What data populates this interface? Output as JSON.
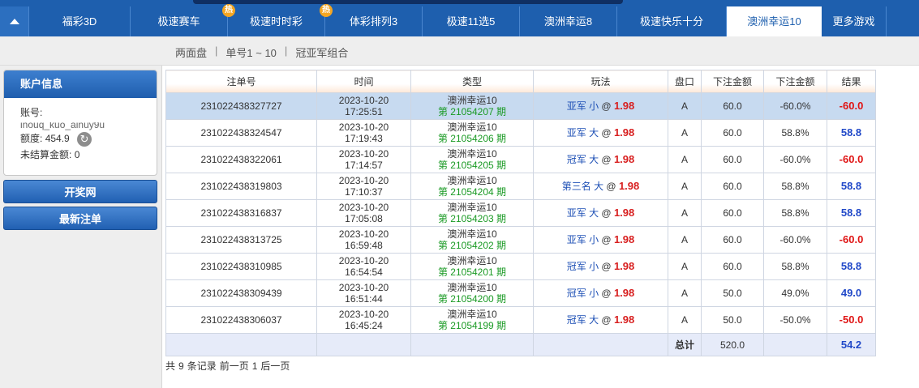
{
  "nav": {
    "tabs": [
      {
        "label": "福彩3D",
        "hot": false,
        "active": false
      },
      {
        "label": "极速赛车",
        "hot": true,
        "active": false
      },
      {
        "label": "极速时时彩",
        "hot": true,
        "active": false
      },
      {
        "label": "体彩排列3",
        "hot": false,
        "active": false
      },
      {
        "label": "极速11选5",
        "hot": false,
        "active": false
      },
      {
        "label": "澳洲幸运8",
        "hot": false,
        "active": false
      },
      {
        "label": "极速快乐十分",
        "hot": false,
        "active": false
      },
      {
        "label": "澳洲幸运10",
        "hot": false,
        "active": true
      },
      {
        "label": "更多游戏",
        "hot": false,
        "active": false
      }
    ],
    "hot_label": "热"
  },
  "subnav": {
    "items": [
      "两面盘",
      "单号1 ~ 10",
      "冠亚军组合"
    ],
    "separator": "|"
  },
  "sidebar": {
    "account_title": "账户信息",
    "account_label": "账号:",
    "account_value_masked": "inouq_kuo_ainuy9u",
    "quota_label": "额度:",
    "quota_value": "454.9",
    "unsettled_label": "未结算金额:",
    "unsettled_value": "0",
    "refresh_icon": "↻",
    "buttons": [
      "开奖网",
      "最新注单"
    ]
  },
  "table": {
    "headers": [
      "注单号",
      "时间",
      "类型",
      "玩法",
      "盘口",
      "下注金额",
      "下注金额",
      "结果"
    ],
    "rows": [
      {
        "id": "231022438327727",
        "date": "2023-10-20",
        "time": "17:25:51",
        "game": "澳洲幸运10",
        "issue": "第 21054207 期",
        "play": "亚军 小",
        "at": "@",
        "odds": "1.98",
        "pan": "A",
        "amount": "60.0",
        "pct": "-60.0%",
        "result": "-60.0",
        "sign": "neg"
      },
      {
        "id": "231022438324547",
        "date": "2023-10-20",
        "time": "17:19:43",
        "game": "澳洲幸运10",
        "issue": "第 21054206 期",
        "play": "亚军 大",
        "at": "@",
        "odds": "1.98",
        "pan": "A",
        "amount": "60.0",
        "pct": "58.8%",
        "result": "58.8",
        "sign": "pos"
      },
      {
        "id": "231022438322061",
        "date": "2023-10-20",
        "time": "17:14:57",
        "game": "澳洲幸运10",
        "issue": "第 21054205 期",
        "play": "冠军 大",
        "at": "@",
        "odds": "1.98",
        "pan": "A",
        "amount": "60.0",
        "pct": "-60.0%",
        "result": "-60.0",
        "sign": "neg"
      },
      {
        "id": "231022438319803",
        "date": "2023-10-20",
        "time": "17:10:37",
        "game": "澳洲幸运10",
        "issue": "第 21054204 期",
        "play": "第三名 大",
        "at": "@",
        "odds": "1.98",
        "pan": "A",
        "amount": "60.0",
        "pct": "58.8%",
        "result": "58.8",
        "sign": "pos"
      },
      {
        "id": "231022438316837",
        "date": "2023-10-20",
        "time": "17:05:08",
        "game": "澳洲幸运10",
        "issue": "第 21054203 期",
        "play": "亚军 大",
        "at": "@",
        "odds": "1.98",
        "pan": "A",
        "amount": "60.0",
        "pct": "58.8%",
        "result": "58.8",
        "sign": "pos"
      },
      {
        "id": "231022438313725",
        "date": "2023-10-20",
        "time": "16:59:48",
        "game": "澳洲幸运10",
        "issue": "第 21054202 期",
        "play": "亚军 小",
        "at": "@",
        "odds": "1.98",
        "pan": "A",
        "amount": "60.0",
        "pct": "-60.0%",
        "result": "-60.0",
        "sign": "neg"
      },
      {
        "id": "231022438310985",
        "date": "2023-10-20",
        "time": "16:54:54",
        "game": "澳洲幸运10",
        "issue": "第 21054201 期",
        "play": "冠军 小",
        "at": "@",
        "odds": "1.98",
        "pan": "A",
        "amount": "60.0",
        "pct": "58.8%",
        "result": "58.8",
        "sign": "pos"
      },
      {
        "id": "231022438309439",
        "date": "2023-10-20",
        "time": "16:51:44",
        "game": "澳洲幸运10",
        "issue": "第 21054200 期",
        "play": "冠军 小",
        "at": "@",
        "odds": "1.98",
        "pan": "A",
        "amount": "50.0",
        "pct": "49.0%",
        "result": "49.0",
        "sign": "pos"
      },
      {
        "id": "231022438306037",
        "date": "2023-10-20",
        "time": "16:45:24",
        "game": "澳洲幸运10",
        "issue": "第 21054199 期",
        "play": "冠军 大",
        "at": "@",
        "odds": "1.98",
        "pan": "A",
        "amount": "50.0",
        "pct": "-50.0%",
        "result": "-50.0",
        "sign": "neg"
      }
    ],
    "selected_row": 0,
    "total_label": "总计",
    "total_amount": "520.0",
    "total_result": "54.2"
  },
  "pager": {
    "text_prefix": "共",
    "count": "9",
    "text_suffix": "条记录",
    "prev": "前一页",
    "page": "1",
    "next": "后一页"
  },
  "colors": {
    "nav_blue": "#1e5fae",
    "odds_red": "#d81f1f",
    "result_negative": "#e01515",
    "result_positive": "#2048c8",
    "issue_green": "#1a9a24",
    "hot_badge": "#f4a623"
  }
}
